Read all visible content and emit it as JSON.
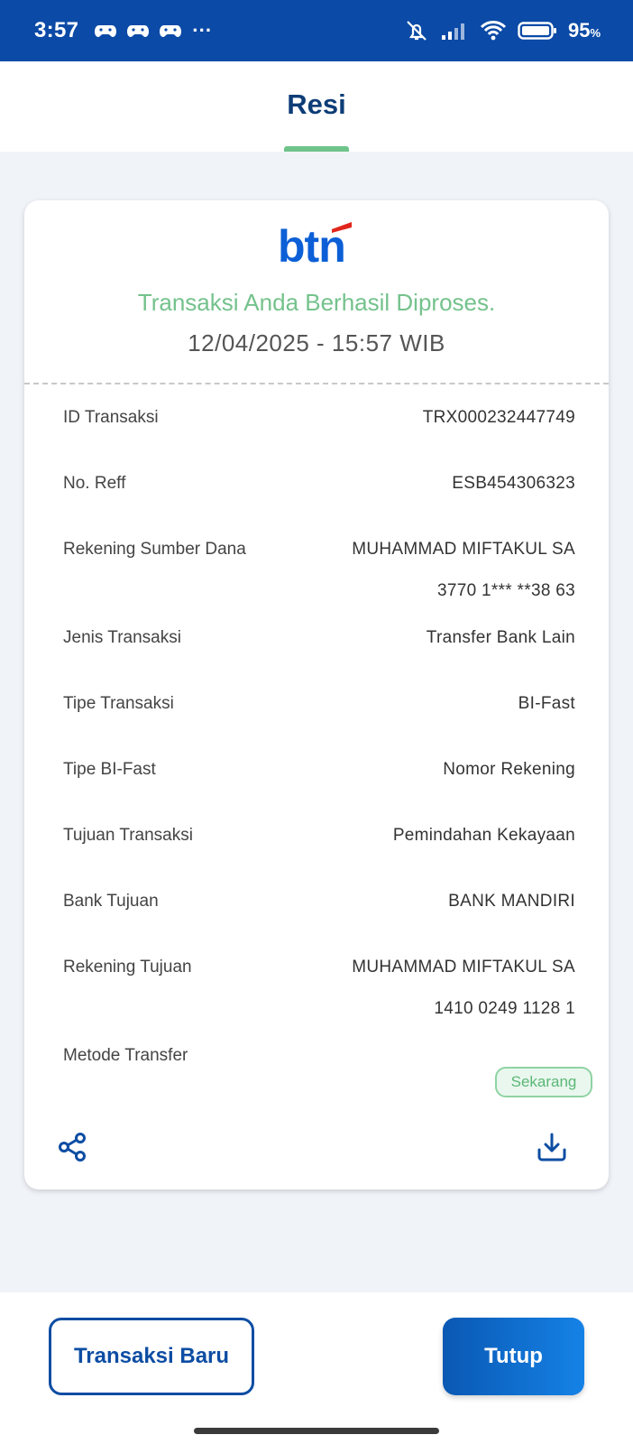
{
  "status_bar": {
    "time": "3:57",
    "notification_icons": [
      "game-controller-icon",
      "game-controller-icon",
      "game-controller-icon"
    ],
    "more": "···",
    "battery": "95",
    "battery_unit": "%"
  },
  "header": {
    "title": "Resi"
  },
  "receipt": {
    "logo_text": "btn",
    "message": "Transaksi Anda Berhasil Diproses.",
    "datetime": "12/04/2025 - 15:57 WIB",
    "rows": [
      {
        "label": "ID Transaksi",
        "value": "TRX000232447749"
      },
      {
        "label": "No. Reff",
        "value": "ESB454306323"
      },
      {
        "label": "Rekening Sumber Dana",
        "value": "MUHAMMAD MIFTAKUL SA",
        "value2": "3770 1*** **38 63"
      },
      {
        "label": "Jenis Transaksi",
        "value": "Transfer Bank Lain"
      },
      {
        "label": "Tipe Transaksi",
        "value": "BI-Fast"
      },
      {
        "label": "Tipe BI-Fast",
        "value": "Nomor Rekening"
      },
      {
        "label": "Tujuan Transaksi",
        "value": "Pemindahan Kekayaan"
      },
      {
        "label": "Bank Tujuan",
        "value": "BANK MANDIRI"
      },
      {
        "label": "Rekening Tujuan",
        "value": "MUHAMMAD MIFTAKUL SA",
        "value2": "1410 0249 1128 1"
      },
      {
        "label": "Metode Transfer",
        "badge": "Sekarang"
      }
    ]
  },
  "actions": {
    "new_transaction": "Transaksi Baru",
    "close": "Tutup"
  },
  "colors": {
    "status_bar": "#0b4aa6",
    "brand_blue": "#0d4da3",
    "logo_red": "#e1251b",
    "success_green": "#74c28c"
  }
}
